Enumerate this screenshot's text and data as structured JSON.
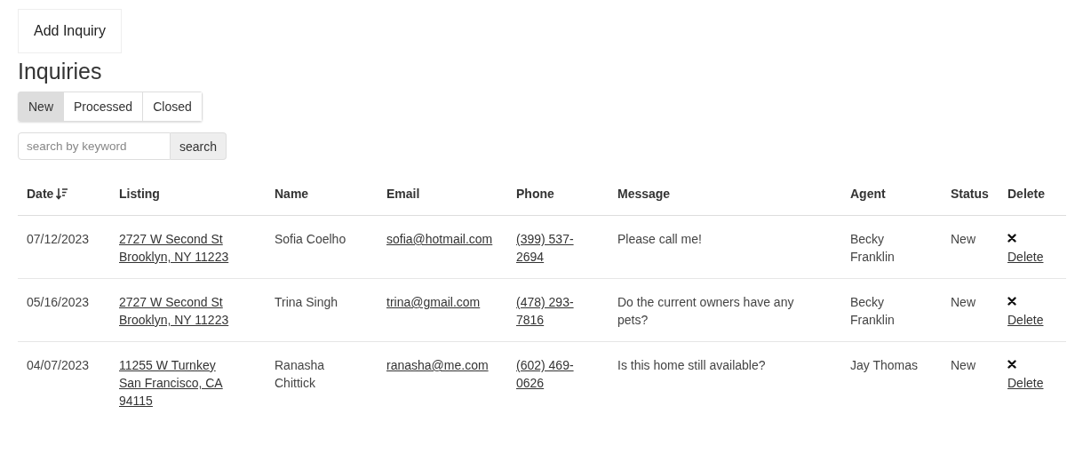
{
  "add_button": "Add Inquiry",
  "heading": "Inquiries",
  "tabs": [
    {
      "label": "New",
      "selected": true
    },
    {
      "label": "Processed",
      "selected": false
    },
    {
      "label": "Closed",
      "selected": false
    }
  ],
  "search": {
    "placeholder": "search by keyword",
    "button": "search"
  },
  "table": {
    "columns": [
      {
        "label": "Date",
        "sorted": true
      },
      {
        "label": "Listing",
        "sorted": false
      },
      {
        "label": "Name",
        "sorted": false
      },
      {
        "label": "Email",
        "sorted": false
      },
      {
        "label": "Phone",
        "sorted": false
      },
      {
        "label": "Message",
        "sorted": false
      },
      {
        "label": "Agent",
        "sorted": false
      },
      {
        "label": "Status",
        "sorted": false
      },
      {
        "label": "Delete",
        "sorted": false
      }
    ],
    "rows": [
      {
        "date": "07/12/2023",
        "listing": "2727 W Second St Brooklyn, NY 11223",
        "name": "Sofia Coelho",
        "email": "sofia@hotmail.com",
        "phone": "(399) 537-2694",
        "message": "Please call me!",
        "agent": "Becky Franklin",
        "status": "New",
        "delete": "Delete"
      },
      {
        "date": "05/16/2023",
        "listing": "2727 W Second St Brooklyn, NY 11223",
        "name": "Trina Singh",
        "email": "trina@gmail.com",
        "phone": "(478) 293-7816",
        "message": "Do the current owners have any pets?",
        "agent": "Becky Franklin",
        "status": "New",
        "delete": "Delete"
      },
      {
        "date": "04/07/2023",
        "listing": "11255 W Turnkey San Francisco, CA 94115",
        "name": "Ranasha Chittick",
        "email": "ranasha@me.com",
        "phone": "(602) 469-0626",
        "message": "Is this home still available?",
        "agent": "Jay Thomas",
        "status": "New",
        "delete": "Delete"
      }
    ]
  }
}
